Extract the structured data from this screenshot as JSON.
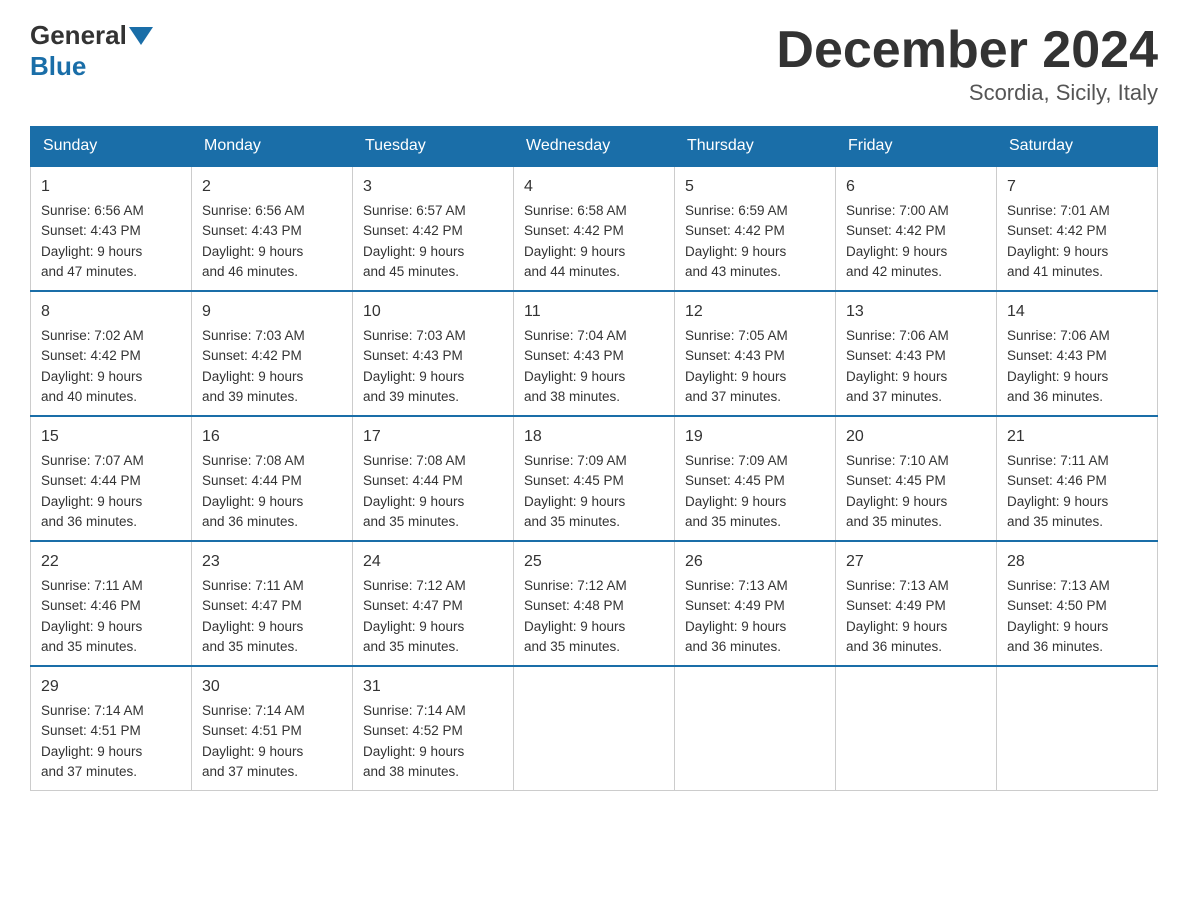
{
  "header": {
    "logo_general": "General",
    "logo_blue": "Blue",
    "month_title": "December 2024",
    "location": "Scordia, Sicily, Italy"
  },
  "days_of_week": [
    "Sunday",
    "Monday",
    "Tuesday",
    "Wednesday",
    "Thursday",
    "Friday",
    "Saturday"
  ],
  "weeks": [
    [
      {
        "day": "1",
        "sunrise": "6:56 AM",
        "sunset": "4:43 PM",
        "daylight": "9 hours and 47 minutes."
      },
      {
        "day": "2",
        "sunrise": "6:56 AM",
        "sunset": "4:43 PM",
        "daylight": "9 hours and 46 minutes."
      },
      {
        "day": "3",
        "sunrise": "6:57 AM",
        "sunset": "4:42 PM",
        "daylight": "9 hours and 45 minutes."
      },
      {
        "day": "4",
        "sunrise": "6:58 AM",
        "sunset": "4:42 PM",
        "daylight": "9 hours and 44 minutes."
      },
      {
        "day": "5",
        "sunrise": "6:59 AM",
        "sunset": "4:42 PM",
        "daylight": "9 hours and 43 minutes."
      },
      {
        "day": "6",
        "sunrise": "7:00 AM",
        "sunset": "4:42 PM",
        "daylight": "9 hours and 42 minutes."
      },
      {
        "day": "7",
        "sunrise": "7:01 AM",
        "sunset": "4:42 PM",
        "daylight": "9 hours and 41 minutes."
      }
    ],
    [
      {
        "day": "8",
        "sunrise": "7:02 AM",
        "sunset": "4:42 PM",
        "daylight": "9 hours and 40 minutes."
      },
      {
        "day": "9",
        "sunrise": "7:03 AM",
        "sunset": "4:42 PM",
        "daylight": "9 hours and 39 minutes."
      },
      {
        "day": "10",
        "sunrise": "7:03 AM",
        "sunset": "4:43 PM",
        "daylight": "9 hours and 39 minutes."
      },
      {
        "day": "11",
        "sunrise": "7:04 AM",
        "sunset": "4:43 PM",
        "daylight": "9 hours and 38 minutes."
      },
      {
        "day": "12",
        "sunrise": "7:05 AM",
        "sunset": "4:43 PM",
        "daylight": "9 hours and 37 minutes."
      },
      {
        "day": "13",
        "sunrise": "7:06 AM",
        "sunset": "4:43 PM",
        "daylight": "9 hours and 37 minutes."
      },
      {
        "day": "14",
        "sunrise": "7:06 AM",
        "sunset": "4:43 PM",
        "daylight": "9 hours and 36 minutes."
      }
    ],
    [
      {
        "day": "15",
        "sunrise": "7:07 AM",
        "sunset": "4:44 PM",
        "daylight": "9 hours and 36 minutes."
      },
      {
        "day": "16",
        "sunrise": "7:08 AM",
        "sunset": "4:44 PM",
        "daylight": "9 hours and 36 minutes."
      },
      {
        "day": "17",
        "sunrise": "7:08 AM",
        "sunset": "4:44 PM",
        "daylight": "9 hours and 35 minutes."
      },
      {
        "day": "18",
        "sunrise": "7:09 AM",
        "sunset": "4:45 PM",
        "daylight": "9 hours and 35 minutes."
      },
      {
        "day": "19",
        "sunrise": "7:09 AM",
        "sunset": "4:45 PM",
        "daylight": "9 hours and 35 minutes."
      },
      {
        "day": "20",
        "sunrise": "7:10 AM",
        "sunset": "4:45 PM",
        "daylight": "9 hours and 35 minutes."
      },
      {
        "day": "21",
        "sunrise": "7:11 AM",
        "sunset": "4:46 PM",
        "daylight": "9 hours and 35 minutes."
      }
    ],
    [
      {
        "day": "22",
        "sunrise": "7:11 AM",
        "sunset": "4:46 PM",
        "daylight": "9 hours and 35 minutes."
      },
      {
        "day": "23",
        "sunrise": "7:11 AM",
        "sunset": "4:47 PM",
        "daylight": "9 hours and 35 minutes."
      },
      {
        "day": "24",
        "sunrise": "7:12 AM",
        "sunset": "4:47 PM",
        "daylight": "9 hours and 35 minutes."
      },
      {
        "day": "25",
        "sunrise": "7:12 AM",
        "sunset": "4:48 PM",
        "daylight": "9 hours and 35 minutes."
      },
      {
        "day": "26",
        "sunrise": "7:13 AM",
        "sunset": "4:49 PM",
        "daylight": "9 hours and 36 minutes."
      },
      {
        "day": "27",
        "sunrise": "7:13 AM",
        "sunset": "4:49 PM",
        "daylight": "9 hours and 36 minutes."
      },
      {
        "day": "28",
        "sunrise": "7:13 AM",
        "sunset": "4:50 PM",
        "daylight": "9 hours and 36 minutes."
      }
    ],
    [
      {
        "day": "29",
        "sunrise": "7:14 AM",
        "sunset": "4:51 PM",
        "daylight": "9 hours and 37 minutes."
      },
      {
        "day": "30",
        "sunrise": "7:14 AM",
        "sunset": "4:51 PM",
        "daylight": "9 hours and 37 minutes."
      },
      {
        "day": "31",
        "sunrise": "7:14 AM",
        "sunset": "4:52 PM",
        "daylight": "9 hours and 38 minutes."
      },
      null,
      null,
      null,
      null
    ]
  ],
  "labels": {
    "sunrise": "Sunrise:",
    "sunset": "Sunset:",
    "daylight": "Daylight:"
  }
}
